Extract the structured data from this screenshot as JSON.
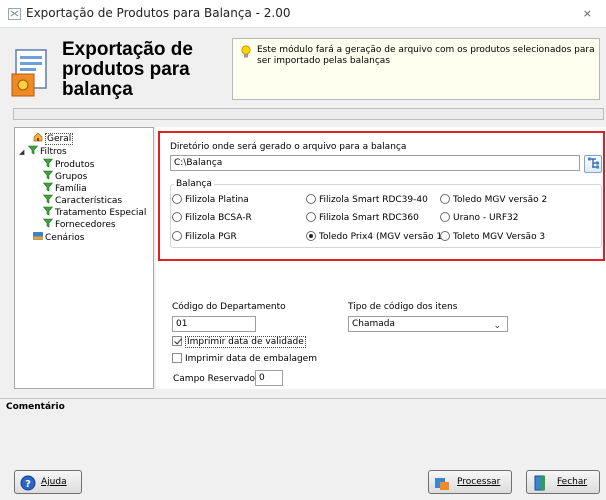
{
  "window": {
    "title": "Exportação de Produtos para Balança - 2.00",
    "close": "×"
  },
  "header": {
    "title_line1": "Exportação de",
    "title_line2": "produtos para",
    "title_line3": "balança",
    "info_text": "Este módulo fará a geração de arquivo com os produtos selecionados para ser importado pelas balanças"
  },
  "tree": {
    "geral": "Geral",
    "filtros": "Filtros",
    "children": [
      "Produtos",
      "Grupos",
      "Família",
      "Características",
      "Tratamento Especial",
      "Fornecedores"
    ],
    "cenarios": "Cenários"
  },
  "directory": {
    "label": "Diretório onde será gerado o arquivo para a balança",
    "value": "C:\\Balança"
  },
  "balanca": {
    "label": "Balança",
    "options": [
      "Filizola Platina",
      "Filizola Smart RDC39-40",
      "Toledo MGV versão 2",
      "Filizola BCSA-R",
      "Filizola Smart RDC360",
      "Urano - URF32",
      "Filizola PGR",
      "Toledo Prix4 (MGV versão 1)",
      "Toleto MGV Versão 3"
    ],
    "selected_index": 7
  },
  "departamento": {
    "label": "Código do Departamento",
    "value": "01"
  },
  "tipo_codigo": {
    "label": "Tipo de código dos itens",
    "value": "Chamada"
  },
  "checks": {
    "validade": {
      "label": "Imprimir data de validade",
      "checked": true
    },
    "embalagem": {
      "label": "Imprimir data de embalagem",
      "checked": false
    }
  },
  "campo_reservado": {
    "label": "Campo Reservado",
    "value": "0"
  },
  "comentario": {
    "label": "Comentário"
  },
  "buttons": {
    "ajuda": "Ajuda",
    "processar": "Processar",
    "fechar": "Fechar"
  },
  "colors": {
    "accent_red": "#e02020",
    "info_bg": "#fffff0"
  }
}
